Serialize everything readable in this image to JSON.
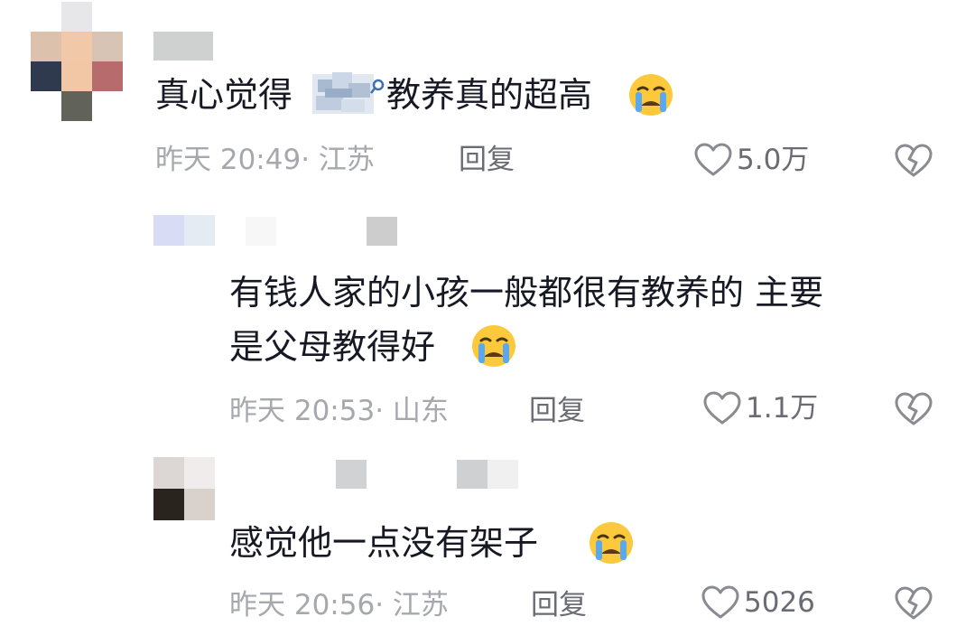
{
  "comments": [
    {
      "text_before": "真心觉得",
      "text_after": "教养真的超高",
      "meta": "昨天 20:49· 江苏",
      "reply": "回复",
      "likes": "5.0万"
    },
    {
      "text_line1": "有钱人家的小孩一般都很有教养的 主要",
      "text_line2": "是父母教得好",
      "meta": "昨天 20:53· 山东",
      "reply": "回复",
      "likes": "1.1万"
    },
    {
      "text": "感觉他一点没有架子",
      "meta": "昨天 20:56· 江苏",
      "reply": "回复",
      "likes": "5026"
    }
  ],
  "icons": {
    "like": "heart-outline-icon",
    "dislike": "broken-heart-icon",
    "emoji": "loudly-crying-face-emoji"
  },
  "colors": {
    "text": "#161823",
    "meta": "#a7a8ad",
    "action": "#6b6c73"
  }
}
